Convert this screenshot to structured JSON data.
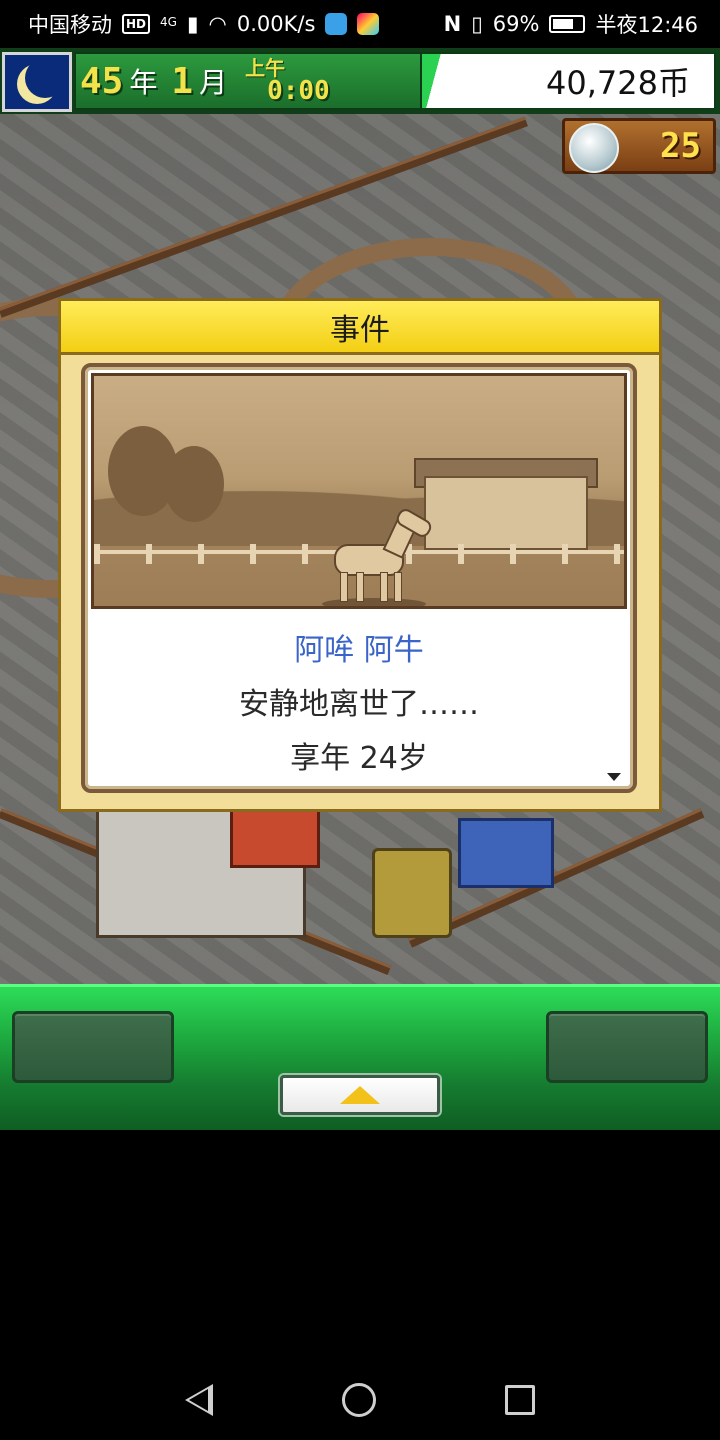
{
  "status_bar": {
    "carrier": "中国移动",
    "hd_badge": "HD",
    "network": "4G",
    "speed": "0.00K/s",
    "nfc": "N",
    "battery_text": "69%",
    "battery_level": 0.69,
    "time": "半夜12:46"
  },
  "hud": {
    "year_num": "45",
    "year_unit": "年",
    "month_num": "1",
    "month_unit": "月",
    "ampm": "上午",
    "clock": "0:00",
    "money": "40,728币",
    "medal_count": "25"
  },
  "dialog": {
    "title": "事件",
    "name": "阿哞 阿牛",
    "line1": "安静地离世了……",
    "line2": "享年 24岁"
  },
  "colors": {
    "hud_green": "#1b6e2b",
    "date_yellow": "#f3e24a",
    "dialog_yellow": "#f3cf14",
    "name_blue": "#3a64c8",
    "controlbar_green": "#1eab40"
  }
}
